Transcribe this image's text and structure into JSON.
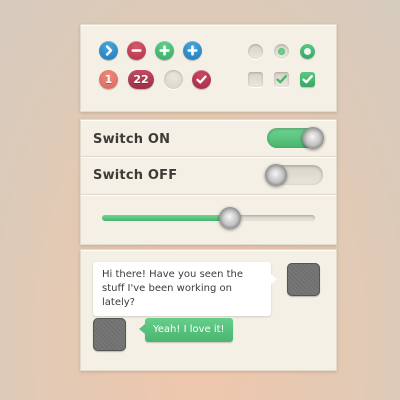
{
  "colors": {
    "accent_green": "#4ab66f",
    "blue": "#1d78b6",
    "red": "#b13045",
    "panel_bg": "#f4f0e6"
  },
  "buttons": {
    "icons": [
      "chevron-right-icon",
      "minus-icon",
      "plus-icon",
      "plus-icon"
    ],
    "badge_one": "1",
    "badge_two": "22"
  },
  "switches": {
    "on_label": "Switch ON",
    "off_label": "Switch OFF",
    "on_state": true,
    "off_state": false
  },
  "slider": {
    "value": 0.6
  },
  "chat": {
    "incoming_message": "Hi there! Have you seen the stuff I've been working on lately?",
    "outgoing_message": "Yeah! I love it!"
  }
}
